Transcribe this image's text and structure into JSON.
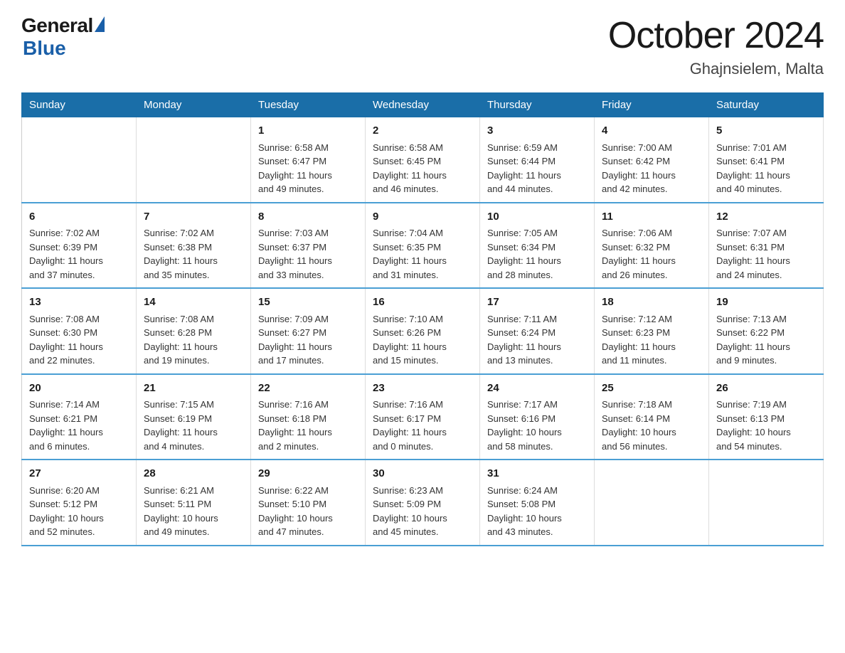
{
  "logo": {
    "general": "General",
    "blue": "Blue"
  },
  "title": "October 2024",
  "subtitle": "Ghajnsielem, Malta",
  "days_of_week": [
    "Sunday",
    "Monday",
    "Tuesday",
    "Wednesday",
    "Thursday",
    "Friday",
    "Saturday"
  ],
  "weeks": [
    [
      {
        "day": "",
        "info": ""
      },
      {
        "day": "",
        "info": ""
      },
      {
        "day": "1",
        "info": "Sunrise: 6:58 AM\nSunset: 6:47 PM\nDaylight: 11 hours\nand 49 minutes."
      },
      {
        "day": "2",
        "info": "Sunrise: 6:58 AM\nSunset: 6:45 PM\nDaylight: 11 hours\nand 46 minutes."
      },
      {
        "day": "3",
        "info": "Sunrise: 6:59 AM\nSunset: 6:44 PM\nDaylight: 11 hours\nand 44 minutes."
      },
      {
        "day": "4",
        "info": "Sunrise: 7:00 AM\nSunset: 6:42 PM\nDaylight: 11 hours\nand 42 minutes."
      },
      {
        "day": "5",
        "info": "Sunrise: 7:01 AM\nSunset: 6:41 PM\nDaylight: 11 hours\nand 40 minutes."
      }
    ],
    [
      {
        "day": "6",
        "info": "Sunrise: 7:02 AM\nSunset: 6:39 PM\nDaylight: 11 hours\nand 37 minutes."
      },
      {
        "day": "7",
        "info": "Sunrise: 7:02 AM\nSunset: 6:38 PM\nDaylight: 11 hours\nand 35 minutes."
      },
      {
        "day": "8",
        "info": "Sunrise: 7:03 AM\nSunset: 6:37 PM\nDaylight: 11 hours\nand 33 minutes."
      },
      {
        "day": "9",
        "info": "Sunrise: 7:04 AM\nSunset: 6:35 PM\nDaylight: 11 hours\nand 31 minutes."
      },
      {
        "day": "10",
        "info": "Sunrise: 7:05 AM\nSunset: 6:34 PM\nDaylight: 11 hours\nand 28 minutes."
      },
      {
        "day": "11",
        "info": "Sunrise: 7:06 AM\nSunset: 6:32 PM\nDaylight: 11 hours\nand 26 minutes."
      },
      {
        "day": "12",
        "info": "Sunrise: 7:07 AM\nSunset: 6:31 PM\nDaylight: 11 hours\nand 24 minutes."
      }
    ],
    [
      {
        "day": "13",
        "info": "Sunrise: 7:08 AM\nSunset: 6:30 PM\nDaylight: 11 hours\nand 22 minutes."
      },
      {
        "day": "14",
        "info": "Sunrise: 7:08 AM\nSunset: 6:28 PM\nDaylight: 11 hours\nand 19 minutes."
      },
      {
        "day": "15",
        "info": "Sunrise: 7:09 AM\nSunset: 6:27 PM\nDaylight: 11 hours\nand 17 minutes."
      },
      {
        "day": "16",
        "info": "Sunrise: 7:10 AM\nSunset: 6:26 PM\nDaylight: 11 hours\nand 15 minutes."
      },
      {
        "day": "17",
        "info": "Sunrise: 7:11 AM\nSunset: 6:24 PM\nDaylight: 11 hours\nand 13 minutes."
      },
      {
        "day": "18",
        "info": "Sunrise: 7:12 AM\nSunset: 6:23 PM\nDaylight: 11 hours\nand 11 minutes."
      },
      {
        "day": "19",
        "info": "Sunrise: 7:13 AM\nSunset: 6:22 PM\nDaylight: 11 hours\nand 9 minutes."
      }
    ],
    [
      {
        "day": "20",
        "info": "Sunrise: 7:14 AM\nSunset: 6:21 PM\nDaylight: 11 hours\nand 6 minutes."
      },
      {
        "day": "21",
        "info": "Sunrise: 7:15 AM\nSunset: 6:19 PM\nDaylight: 11 hours\nand 4 minutes."
      },
      {
        "day": "22",
        "info": "Sunrise: 7:16 AM\nSunset: 6:18 PM\nDaylight: 11 hours\nand 2 minutes."
      },
      {
        "day": "23",
        "info": "Sunrise: 7:16 AM\nSunset: 6:17 PM\nDaylight: 11 hours\nand 0 minutes."
      },
      {
        "day": "24",
        "info": "Sunrise: 7:17 AM\nSunset: 6:16 PM\nDaylight: 10 hours\nand 58 minutes."
      },
      {
        "day": "25",
        "info": "Sunrise: 7:18 AM\nSunset: 6:14 PM\nDaylight: 10 hours\nand 56 minutes."
      },
      {
        "day": "26",
        "info": "Sunrise: 7:19 AM\nSunset: 6:13 PM\nDaylight: 10 hours\nand 54 minutes."
      }
    ],
    [
      {
        "day": "27",
        "info": "Sunrise: 6:20 AM\nSunset: 5:12 PM\nDaylight: 10 hours\nand 52 minutes."
      },
      {
        "day": "28",
        "info": "Sunrise: 6:21 AM\nSunset: 5:11 PM\nDaylight: 10 hours\nand 49 minutes."
      },
      {
        "day": "29",
        "info": "Sunrise: 6:22 AM\nSunset: 5:10 PM\nDaylight: 10 hours\nand 47 minutes."
      },
      {
        "day": "30",
        "info": "Sunrise: 6:23 AM\nSunset: 5:09 PM\nDaylight: 10 hours\nand 45 minutes."
      },
      {
        "day": "31",
        "info": "Sunrise: 6:24 AM\nSunset: 5:08 PM\nDaylight: 10 hours\nand 43 minutes."
      },
      {
        "day": "",
        "info": ""
      },
      {
        "day": "",
        "info": ""
      }
    ]
  ]
}
